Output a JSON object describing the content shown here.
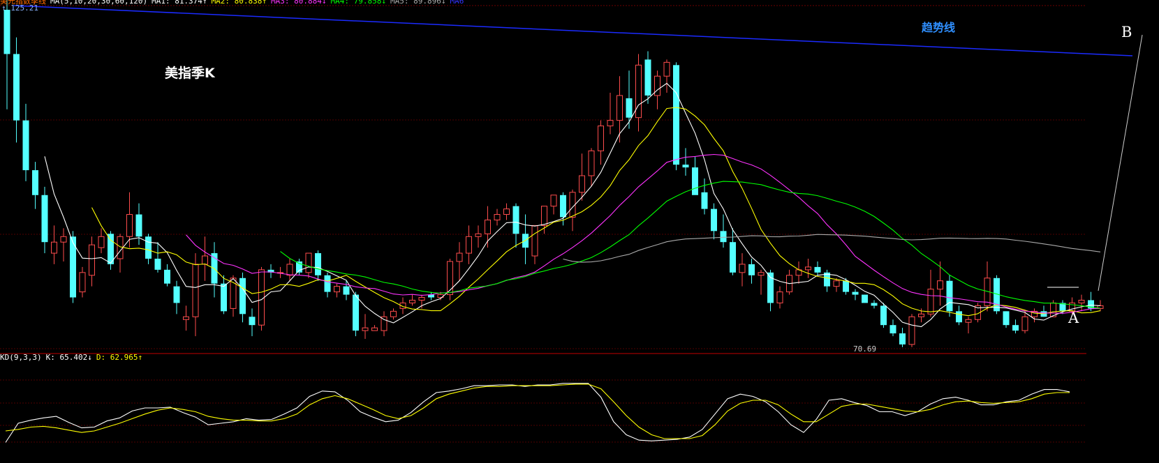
{
  "ma_header": {
    "title": "美元指数季线",
    "params": "MA(5,10,20,30,60,120)",
    "ma1": "MA1: 81.374↑",
    "ma2": "MA2: 80.838↑",
    "ma3": "MA3: 80.884↓",
    "ma4": "MA4: 79.858↓",
    "ma5": "MA5: 89.896↓",
    "ma6": "MA6"
  },
  "kd_header": {
    "params": "KD(9,3,3)",
    "k": "K: 65.402↓",
    "d": "D: 62.965↑"
  },
  "labels": {
    "top_price": "125.21",
    "low_price": "70.69",
    "title": "美指季K",
    "trendline": "趋势线",
    "point_a": "A",
    "point_b": "B"
  },
  "colors": {
    "up": "#ff4d4d",
    "down": "#54ffff",
    "ma5": "#ffffff",
    "ma10": "#ffff00",
    "ma20": "#ff33ff",
    "ma30": "#00ff00",
    "ma60": "#aaaaaa",
    "trend": "#1b2bff",
    "k_line": "#ffffff",
    "d_line": "#ffff00"
  },
  "chart_data": {
    "type": "candlestick",
    "ylim": [
      68,
      128
    ],
    "candles": [
      [
        128.0,
        130.5,
        110.0,
        120.0
      ],
      [
        120.0,
        123.0,
        104.0,
        108.0
      ],
      [
        108.0,
        111.0,
        97.0,
        99.0
      ],
      [
        99.0,
        100.5,
        92.0,
        94.5
      ],
      [
        94.5,
        96.0,
        84.0,
        86.0
      ],
      [
        84.0,
        89.0,
        82.0,
        86.0
      ],
      [
        86.0,
        88.5,
        82.5,
        87.0
      ],
      [
        87.0,
        88.0,
        75.0,
        76.0
      ],
      [
        77.0,
        81.5,
        76.0,
        80.5
      ],
      [
        80.0,
        87.0,
        78.0,
        85.5
      ],
      [
        85.0,
        88.5,
        84.0,
        87.0
      ],
      [
        87.5,
        88.0,
        81.0,
        82.0
      ],
      [
        83.0,
        87.5,
        80.5,
        87.0
      ],
      [
        87.0,
        95.0,
        85.0,
        91.0
      ],
      [
        91.0,
        93.0,
        85.5,
        87.0
      ],
      [
        87.0,
        87.5,
        82.0,
        83.0
      ],
      [
        83.0,
        86.0,
        80.5,
        81.0
      ],
      [
        81.0,
        82.0,
        78.0,
        78.5
      ],
      [
        78.0,
        79.0,
        73.0,
        75.0
      ],
      [
        72.0,
        74.5,
        70.0,
        72.5
      ],
      [
        72.5,
        84.0,
        69.0,
        82.0
      ],
      [
        82.0,
        87.0,
        79.0,
        83.5
      ],
      [
        84.0,
        86.0,
        76.0,
        78.5
      ],
      [
        78.5,
        80.0,
        73.0,
        73.5
      ],
      [
        74.0,
        80.0,
        72.5,
        79.5
      ],
      [
        79.5,
        80.5,
        71.5,
        73.0
      ],
      [
        72.5,
        74.0,
        69.0,
        71.0
      ],
      [
        71.0,
        81.5,
        70.0,
        81.0
      ],
      [
        81.0,
        82.0,
        79.5,
        80.5
      ],
      [
        80.5,
        81.5,
        79.5,
        80.5
      ],
      [
        80.0,
        83.0,
        79.0,
        82.0
      ],
      [
        82.5,
        83.0,
        80.0,
        80.5
      ],
      [
        80.5,
        84.0,
        79.5,
        84.0
      ],
      [
        84.0,
        84.5,
        79.0,
        80.0
      ],
      [
        80.0,
        80.5,
        76.0,
        77.0
      ],
      [
        77.0,
        78.5,
        76.0,
        78.0
      ],
      [
        78.0,
        79.0,
        75.5,
        76.5
      ],
      [
        76.5,
        77.0,
        69.0,
        70.0
      ],
      [
        70.0,
        73.0,
        68.5,
        70.5
      ],
      [
        70.0,
        71.0,
        70.0,
        70.5
      ],
      [
        70.0,
        73.5,
        69.0,
        72.5
      ],
      [
        72.5,
        74.0,
        72.0,
        73.5
      ],
      [
        74.0,
        76.0,
        73.0,
        75.0
      ],
      [
        75.0,
        76.5,
        74.5,
        75.5
      ],
      [
        75.5,
        76.5,
        74.0,
        76.0
      ],
      [
        76.5,
        77.0,
        75.5,
        76.0
      ],
      [
        76.0,
        77.0,
        75.5,
        76.5
      ],
      [
        76.5,
        83.0,
        75.5,
        82.5
      ],
      [
        82.5,
        86.0,
        79.0,
        84.0
      ],
      [
        84.0,
        89.0,
        82.0,
        87.0
      ],
      [
        87.0,
        89.0,
        85.0,
        87.5
      ],
      [
        87.5,
        92.5,
        85.0,
        90.0
      ],
      [
        90.0,
        92.0,
        89.0,
        91.0
      ],
      [
        91.0,
        93.0,
        90.0,
        92.0
      ],
      [
        92.5,
        93.0,
        85.0,
        87.5
      ],
      [
        87.5,
        91.0,
        82.0,
        85.0
      ],
      [
        83.5,
        89.0,
        82.0,
        89.0
      ],
      [
        89.0,
        92.0,
        87.5,
        92.5
      ],
      [
        92.5,
        94.0,
        91.0,
        94.5
      ],
      [
        94.5,
        95.0,
        89.0,
        90.5
      ],
      [
        90.5,
        95.5,
        88.0,
        95.0
      ],
      [
        95.0,
        102.0,
        93.5,
        98.0
      ],
      [
        98.0,
        103.0,
        96.0,
        102.5
      ],
      [
        102.5,
        108.0,
        100.0,
        107.0
      ],
      [
        107.0,
        113.0,
        105.5,
        108.0
      ],
      [
        108.0,
        116.0,
        104.0,
        112.5
      ],
      [
        112.0,
        117.0,
        106.5,
        108.5
      ],
      [
        108.5,
        120.0,
        106.0,
        118.0
      ],
      [
        119.0,
        120.5,
        111.0,
        112.5
      ],
      [
        112.5,
        117.0,
        110.0,
        116.0
      ],
      [
        116.0,
        119.0,
        113.0,
        118.5
      ],
      [
        118.0,
        118.5,
        99.0,
        100.0
      ],
      [
        100.0,
        103.0,
        98.0,
        99.5
      ],
      [
        99.5,
        101.5,
        95.0,
        94.5
      ],
      [
        95.0,
        97.5,
        91.0,
        92.0
      ],
      [
        92.0,
        93.0,
        86.5,
        88.0
      ],
      [
        88.0,
        91.0,
        85.0,
        86.0
      ],
      [
        86.0,
        88.5,
        80.0,
        80.5
      ],
      [
        80.5,
        84.0,
        78.0,
        82.0
      ],
      [
        82.0,
        83.0,
        78.5,
        80.0
      ],
      [
        80.0,
        81.0,
        76.5,
        80.5
      ],
      [
        80.5,
        81.0,
        73.5,
        75.0
      ],
      [
        75.0,
        78.0,
        74.0,
        77.0
      ],
      [
        77.0,
        81.0,
        76.5,
        80.0
      ],
      [
        80.0,
        82.5,
        78.5,
        81.0
      ],
      [
        81.0,
        83.0,
        79.5,
        81.5
      ],
      [
        81.5,
        82.5,
        80.0,
        80.5
      ],
      [
        80.5,
        81.0,
        77.0,
        78.0
      ],
      [
        78.0,
        79.5,
        77.0,
        79.0
      ],
      [
        79.0,
        79.5,
        76.5,
        77.0
      ],
      [
        77.0,
        77.5,
        75.5,
        76.5
      ],
      [
        76.5,
        76.5,
        75.0,
        75.0
      ],
      [
        75.0,
        75.5,
        74.0,
        74.5
      ],
      [
        74.5,
        75.0,
        70.5,
        71.0
      ],
      [
        71.0,
        72.0,
        69.0,
        69.5
      ],
      [
        69.5,
        70.5,
        67.0,
        67.5
      ],
      [
        67.5,
        73.0,
        67.0,
        72.5
      ],
      [
        72.5,
        74.0,
        71.5,
        73.0
      ],
      [
        73.0,
        81.0,
        72.5,
        77.5
      ],
      [
        77.5,
        82.5,
        74.5,
        79.0
      ],
      [
        79.0,
        80.0,
        72.5,
        73.5
      ],
      [
        73.5,
        74.5,
        71.0,
        71.5
      ],
      [
        71.5,
        72.5,
        69.5,
        72.0
      ],
      [
        72.0,
        75.0,
        71.5,
        74.5
      ],
      [
        74.5,
        82.5,
        73.5,
        79.5
      ],
      [
        79.5,
        80.0,
        73.0,
        73.5
      ],
      [
        73.5,
        73.5,
        70.5,
        71.0
      ],
      [
        71.0,
        72.0,
        69.5,
        70.0
      ],
      [
        70.0,
        73.5,
        69.5,
        72.5
      ],
      [
        72.5,
        74.0,
        71.5,
        73.5
      ],
      [
        73.5,
        74.5,
        72.5,
        72.5
      ],
      [
        72.5,
        75.5,
        72.5,
        75.0
      ],
      [
        75.0,
        75.5,
        73.0,
        73.5
      ],
      [
        73.5,
        76.0,
        73.0,
        75.0
      ],
      [
        75.0,
        76.5,
        73.5,
        75.5
      ],
      [
        75.5,
        77.0,
        73.5,
        74.0
      ],
      [
        74.0,
        75.5,
        73.5,
        74.5
      ]
    ],
    "kd_k": [
      5,
      30,
      34,
      37,
      39,
      31,
      24,
      25,
      33,
      37,
      46,
      50,
      50,
      51,
      44,
      38,
      28,
      30,
      32,
      36,
      34,
      35,
      42,
      50,
      65,
      72,
      71,
      60,
      45,
      38,
      32,
      34,
      44,
      58,
      70,
      72,
      75,
      79,
      79,
      80,
      80,
      78,
      80,
      80,
      82,
      82,
      82,
      64,
      32,
      15,
      8,
      7,
      8,
      9,
      12,
      22,
      42,
      62,
      68,
      65,
      58,
      45,
      28,
      18,
      35,
      60,
      62,
      57,
      53,
      45,
      45,
      40,
      45,
      55,
      62,
      64,
      60,
      54,
      54,
      58,
      60,
      68,
      74,
      74,
      71
    ],
    "kd_d": [
      20,
      22,
      25,
      26,
      24,
      21,
      18,
      20,
      25,
      30,
      36,
      42,
      47,
      50,
      48,
      45,
      39,
      36,
      34,
      34,
      33,
      33,
      36,
      42,
      54,
      62,
      66,
      62,
      55,
      48,
      40,
      36,
      40,
      50,
      62,
      68,
      72,
      76,
      78,
      78,
      79,
      79,
      79,
      79,
      80,
      81,
      81,
      75,
      58,
      40,
      25,
      15,
      10,
      10,
      10,
      14,
      28,
      46,
      56,
      60,
      60,
      54,
      42,
      32,
      32,
      42,
      52,
      55,
      55,
      52,
      49,
      46,
      45,
      48,
      54,
      58,
      59,
      57,
      56,
      57,
      58,
      62,
      68,
      70,
      70
    ],
    "ma_overlay_lines": [
      "MA5",
      "MA10",
      "MA20",
      "MA30",
      "MA60"
    ],
    "kd_ylim": [
      0,
      100
    ]
  }
}
